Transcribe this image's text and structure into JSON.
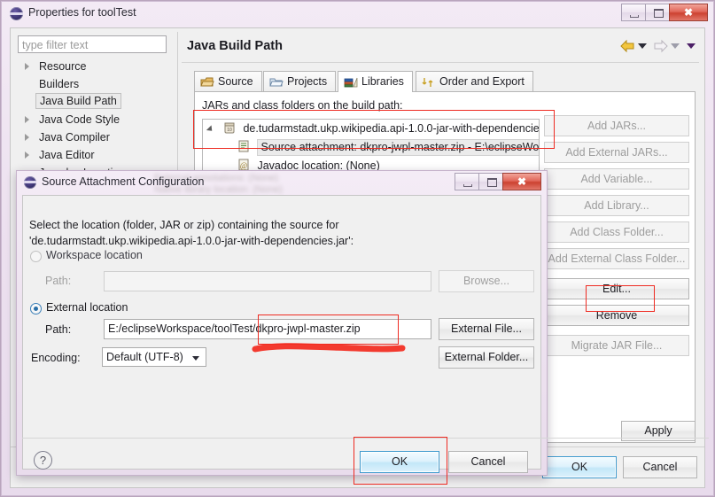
{
  "main_window": {
    "title": "Properties for toolTest",
    "title_icon": "eclipse-icon",
    "controls": {
      "minimize": "minimize-icon",
      "maximize": "maximize-icon",
      "close": "close-icon"
    },
    "filter": {
      "placeholder": "type filter text",
      "value": ""
    },
    "sidebar": {
      "items": [
        {
          "label": "Resource",
          "expandable": true,
          "selected": false
        },
        {
          "label": "Builders",
          "expandable": false,
          "selected": false
        },
        {
          "label": "Java Build Path",
          "expandable": false,
          "selected": true
        },
        {
          "label": "Java Code Style",
          "expandable": true,
          "selected": false
        },
        {
          "label": "Java Compiler",
          "expandable": true,
          "selected": false
        },
        {
          "label": "Java Editor",
          "expandable": true,
          "selected": false
        },
        {
          "label": "Javadoc Location",
          "expandable": false,
          "selected": false
        }
      ]
    },
    "page": {
      "title": "Java Build Path",
      "nav": {
        "back": "back-arrow-icon",
        "forward": "forward-arrow-icon",
        "menu": "dropdown-caret-icon"
      },
      "tabs": [
        {
          "label": "Source",
          "icon": "source-folder-icon",
          "active": false
        },
        {
          "label": "Projects",
          "icon": "projects-folder-icon",
          "active": false
        },
        {
          "label": "Libraries",
          "icon": "libraries-books-icon",
          "active": true
        },
        {
          "label": "Order and Export",
          "icon": "order-export-icon",
          "active": false
        }
      ],
      "jars_label": "JARs and class folders on the build path:",
      "tree": [
        {
          "label": "de.tudarmstadt.ukp.wikipedia.api-1.0.0-jar-with-dependencie",
          "icon": "jar-icon",
          "indent": 0,
          "twisty": true,
          "selected": false
        },
        {
          "label": "Source attachment: dkpro-jwpl-master.zip - E:\\eclipseWo",
          "icon": "source-attachment-icon",
          "indent": 1,
          "twisty": false,
          "selected": true
        },
        {
          "label": "Javadoc location: (None)",
          "icon": "javadoc-icon",
          "indent": 1,
          "twisty": false,
          "selected": false
        }
      ],
      "side_buttons": [
        {
          "label": "Add JARs...",
          "enabled": false
        },
        {
          "label": "Add External JARs...",
          "enabled": false
        },
        {
          "label": "Add Variable...",
          "enabled": false
        },
        {
          "label": "Add Library...",
          "enabled": false
        },
        {
          "label": "Add Class Folder...",
          "enabled": false
        },
        {
          "label": "Add External Class Folder...",
          "enabled": false
        },
        {
          "label": "Edit...",
          "enabled": true
        },
        {
          "label": "Remove",
          "enabled": true
        },
        {
          "label": "Migrate JAR File...",
          "enabled": false
        }
      ],
      "apply_label": "Apply"
    },
    "footer": {
      "ok_label": "OK",
      "cancel_label": "Cancel"
    }
  },
  "dialog": {
    "title": "Source Attachment Configuration",
    "title_icon": "eclipse-icon",
    "ghost_text_line1": "External annotations: (None)",
    "ghost_text_line2": "Native library location: (None)",
    "controls": {
      "minimize": "minimize-icon",
      "maximize": "maximize-icon",
      "close": "close-icon"
    },
    "description_line1": "Select the location (folder, JAR or zip) containing the source for",
    "description_line2": "'de.tudarmstadt.ukp.wikipedia.api-1.0.0-jar-with-dependencies.jar':",
    "workspace": {
      "radio_label": "Workspace location",
      "selected": false,
      "path_label": "Path:",
      "path_value": "",
      "browse_label": "Browse..."
    },
    "external": {
      "radio_label": "External location",
      "selected": true,
      "path_label": "Path:",
      "path_value": "E:/eclipseWorkspace/toolTest/dkpro-jwpl-master.zip",
      "external_file_label": "External File...",
      "external_folder_label": "External Folder..."
    },
    "encoding": {
      "label": "Encoding:",
      "value": "Default (UTF-8)",
      "caret_icon": "chevron-down-icon"
    },
    "help_icon": "help-question-icon",
    "ok_label": "OK",
    "cancel_label": "Cancel"
  },
  "annotations": {
    "highlight_color": "#ee2b22",
    "boxes": [
      {
        "name": "source-attachment-row-highlight"
      },
      {
        "name": "edit-button-highlight"
      },
      {
        "name": "path-value-highlight"
      },
      {
        "name": "dialog-ok-highlight"
      }
    ],
    "underline": {
      "name": "path-underline-stroke"
    }
  },
  "colors": {
    "accent_blue": "#3c99cd",
    "window_chrome": "#ece0ef",
    "panel_bg": "#f0f0f0",
    "annotation_red": "#ee2b22"
  }
}
